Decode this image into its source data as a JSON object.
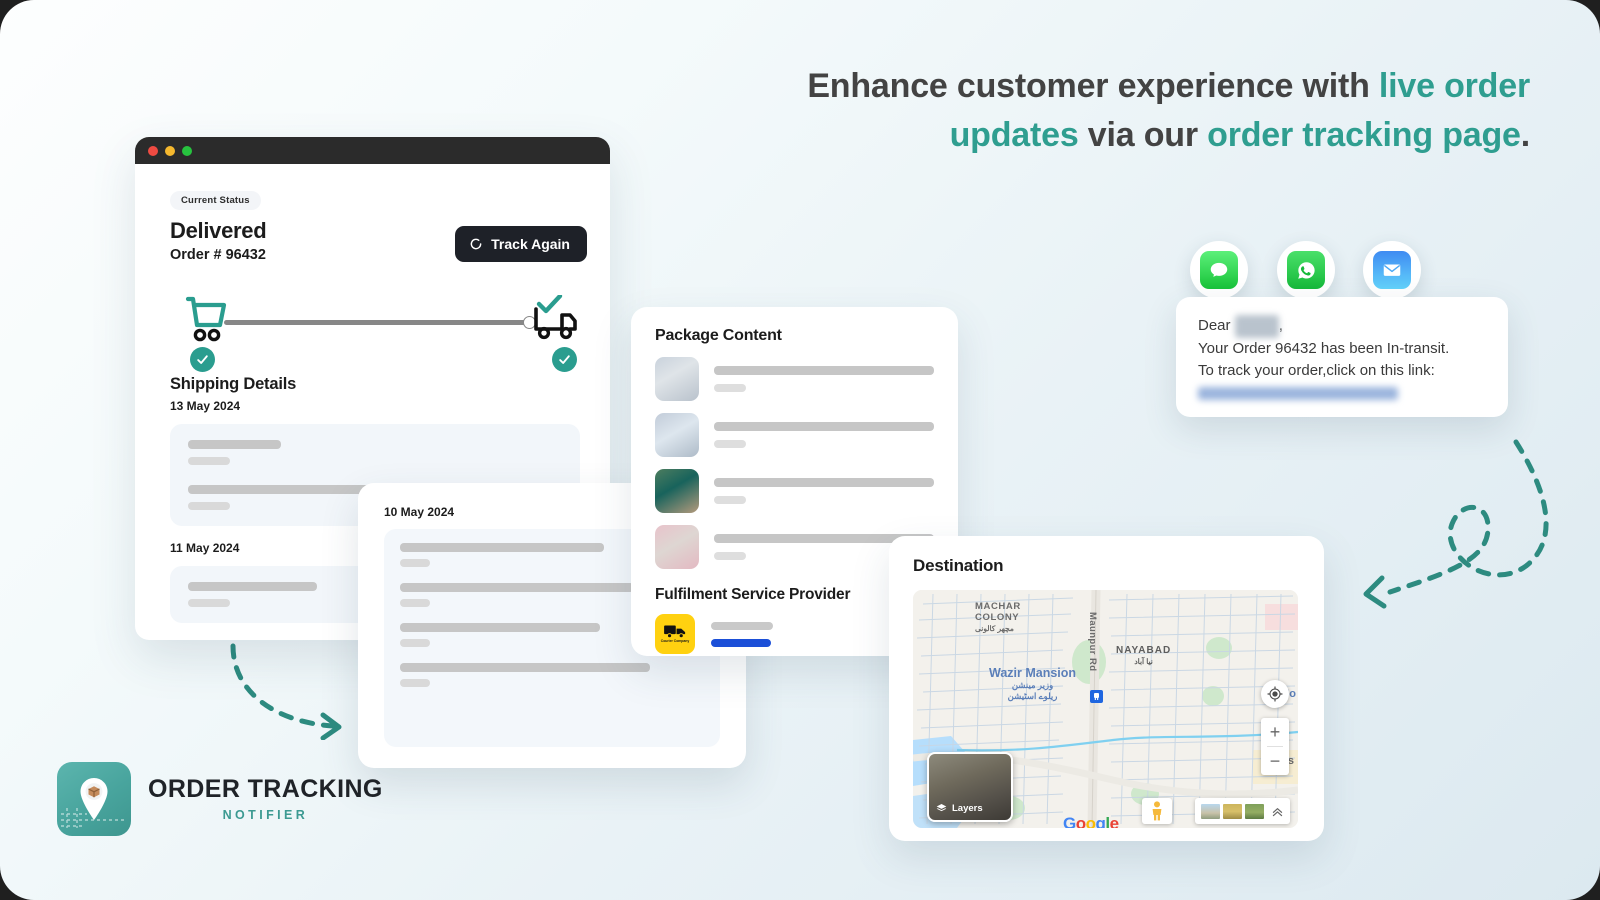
{
  "headline": {
    "part1": "Enhance customer experience with ",
    "accent1": "live order updates",
    "part2": " via our ",
    "accent2": "order tracking page",
    "part3": "."
  },
  "browser": {
    "status_label": "Current Status",
    "status_value": "Delivered",
    "order_number": "Order # 96432",
    "track_button": "Track Again",
    "shipping_title": "Shipping Details",
    "date_1": "13 May 2024",
    "date_2": "11 May 2024",
    "cart_icon": "shopping-cart-icon",
    "truck_icon": "delivery-truck-icon",
    "check_icon": "check-circle-icon"
  },
  "card_10may": {
    "date": "10 May 2024",
    "rows": 4
  },
  "package": {
    "title": "Package Content",
    "items": [
      {
        "thumb_desc": "apparel-light-blue-grey"
      },
      {
        "thumb_desc": "apparel-light-blue"
      },
      {
        "thumb_desc": "apparel-teal-green"
      },
      {
        "thumb_desc": "apparel-pink"
      }
    ],
    "fulfilment_title": "Fulfilment Service Provider",
    "courier_badge_text": "Courier Company",
    "courier_icon": "truck-icon"
  },
  "destination": {
    "title": "Destination",
    "map": {
      "labels": {
        "machar": "MACHAR COLONY",
        "machar_urdu": "مچھر کالونی",
        "nayabad": "NAYABAD",
        "nayabad_urdu": "نیا آباد",
        "wazir": "Wazir Mansion",
        "wazir_urdu_1": "وزیر مینشن",
        "wazir_urdu_2": "ریلوے اسٹیشن",
        "maunpur": "Maunpur Rd",
        "partial_right_top": "Ho",
        "partial_right_bottom": "Has"
      },
      "layers_button": "Layers",
      "zoom_in": "+",
      "zoom_out": "−",
      "watermark": "Google",
      "locate_icon": "my-location-icon",
      "pegman_icon": "street-view-pegman-icon",
      "expand_icon": "chevron-up-icon",
      "layers_icon": "layers-icon"
    }
  },
  "notification": {
    "greeting": "Dear",
    "greeting_name_redacted": "Name",
    "comma": ",",
    "line2": "Your Order 96432 has been In-transit.",
    "line3": "To track your order,click on this link:",
    "link_redacted": "www.trackyourorder.com",
    "channels": [
      {
        "name": "sms-icon",
        "color": "#32c759"
      },
      {
        "name": "whatsapp-icon",
        "color": "#25d366"
      },
      {
        "name": "email-icon",
        "color": "#4aa8f5"
      }
    ]
  },
  "logo": {
    "title": "ORDER TRACKING",
    "subtitle": "NOTIFIER",
    "mark_icon": "map-pin-package-icon"
  },
  "colors": {
    "teal": "#2a9d8f",
    "headline_dark": "#434343",
    "dark_button": "#1e2128",
    "courier_yellow": "#ffd110",
    "courier_blue": "#1b4fd8"
  }
}
